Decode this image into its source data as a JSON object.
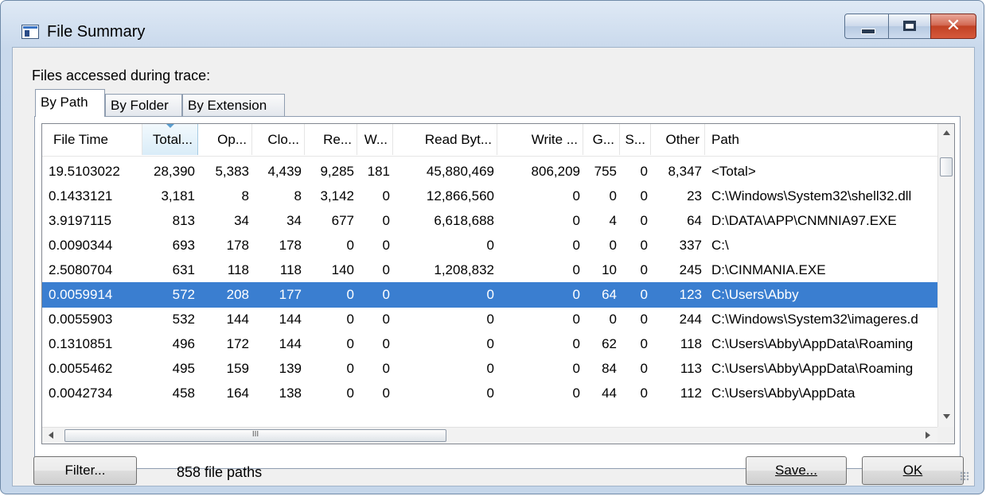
{
  "window": {
    "title": "File Summary",
    "controls": [
      "minimize",
      "maximize",
      "close"
    ]
  },
  "caption": "Files accessed during trace:",
  "tabs": [
    {
      "label": "By Path",
      "active": true
    },
    {
      "label": "By Folder",
      "active": false
    },
    {
      "label": "By Extension",
      "active": false
    }
  ],
  "table": {
    "columns": [
      "File Time",
      "Total...",
      "Op...",
      "Clo...",
      "Re...",
      "W...",
      "Read Byt...",
      "Write ...",
      "G...",
      "S...",
      "Other",
      "Path"
    ],
    "sorted_column": "Total...",
    "rows": [
      [
        "19.5103022",
        "28,390",
        "5,383",
        "4,439",
        "9,285",
        "181",
        "45,880,469",
        "806,209",
        "755",
        "0",
        "8,347",
        "<Total>"
      ],
      [
        "0.1433121",
        "3,181",
        "8",
        "8",
        "3,142",
        "0",
        "12,866,560",
        "0",
        "0",
        "0",
        "23",
        "C:\\Windows\\System32\\shell32.dll"
      ],
      [
        "3.9197115",
        "813",
        "34",
        "34",
        "677",
        "0",
        "6,618,688",
        "0",
        "4",
        "0",
        "64",
        "D:\\DATA\\APP\\CNMNIA97.EXE"
      ],
      [
        "0.0090344",
        "693",
        "178",
        "178",
        "0",
        "0",
        "0",
        "0",
        "0",
        "0",
        "337",
        "C:\\"
      ],
      [
        "2.5080704",
        "631",
        "118",
        "118",
        "140",
        "0",
        "1,208,832",
        "0",
        "10",
        "0",
        "245",
        "D:\\CINMANIA.EXE"
      ],
      [
        "0.0059914",
        "572",
        "208",
        "177",
        "0",
        "0",
        "0",
        "0",
        "64",
        "0",
        "123",
        "C:\\Users\\Abby"
      ],
      [
        "0.0055903",
        "532",
        "144",
        "144",
        "0",
        "0",
        "0",
        "0",
        "0",
        "0",
        "244",
        "C:\\Windows\\System32\\imageres.d"
      ],
      [
        "0.1310851",
        "496",
        "172",
        "144",
        "0",
        "0",
        "0",
        "0",
        "62",
        "0",
        "118",
        "C:\\Users\\Abby\\AppData\\Roaming"
      ],
      [
        "0.0055462",
        "495",
        "159",
        "139",
        "0",
        "0",
        "0",
        "0",
        "84",
        "0",
        "113",
        "C:\\Users\\Abby\\AppData\\Roaming"
      ],
      [
        "0.0042734",
        "458",
        "164",
        "138",
        "0",
        "0",
        "0",
        "0",
        "44",
        "0",
        "112",
        "C:\\Users\\Abby\\AppData"
      ]
    ],
    "selected_row": 5,
    "hscroll_label": "III"
  },
  "buttons": {
    "filter": "Filter...",
    "save": "Save...",
    "ok": "OK"
  },
  "status": "858 file paths",
  "colors": {
    "selection": "#3a7ed0",
    "close_button": "#c14124"
  }
}
